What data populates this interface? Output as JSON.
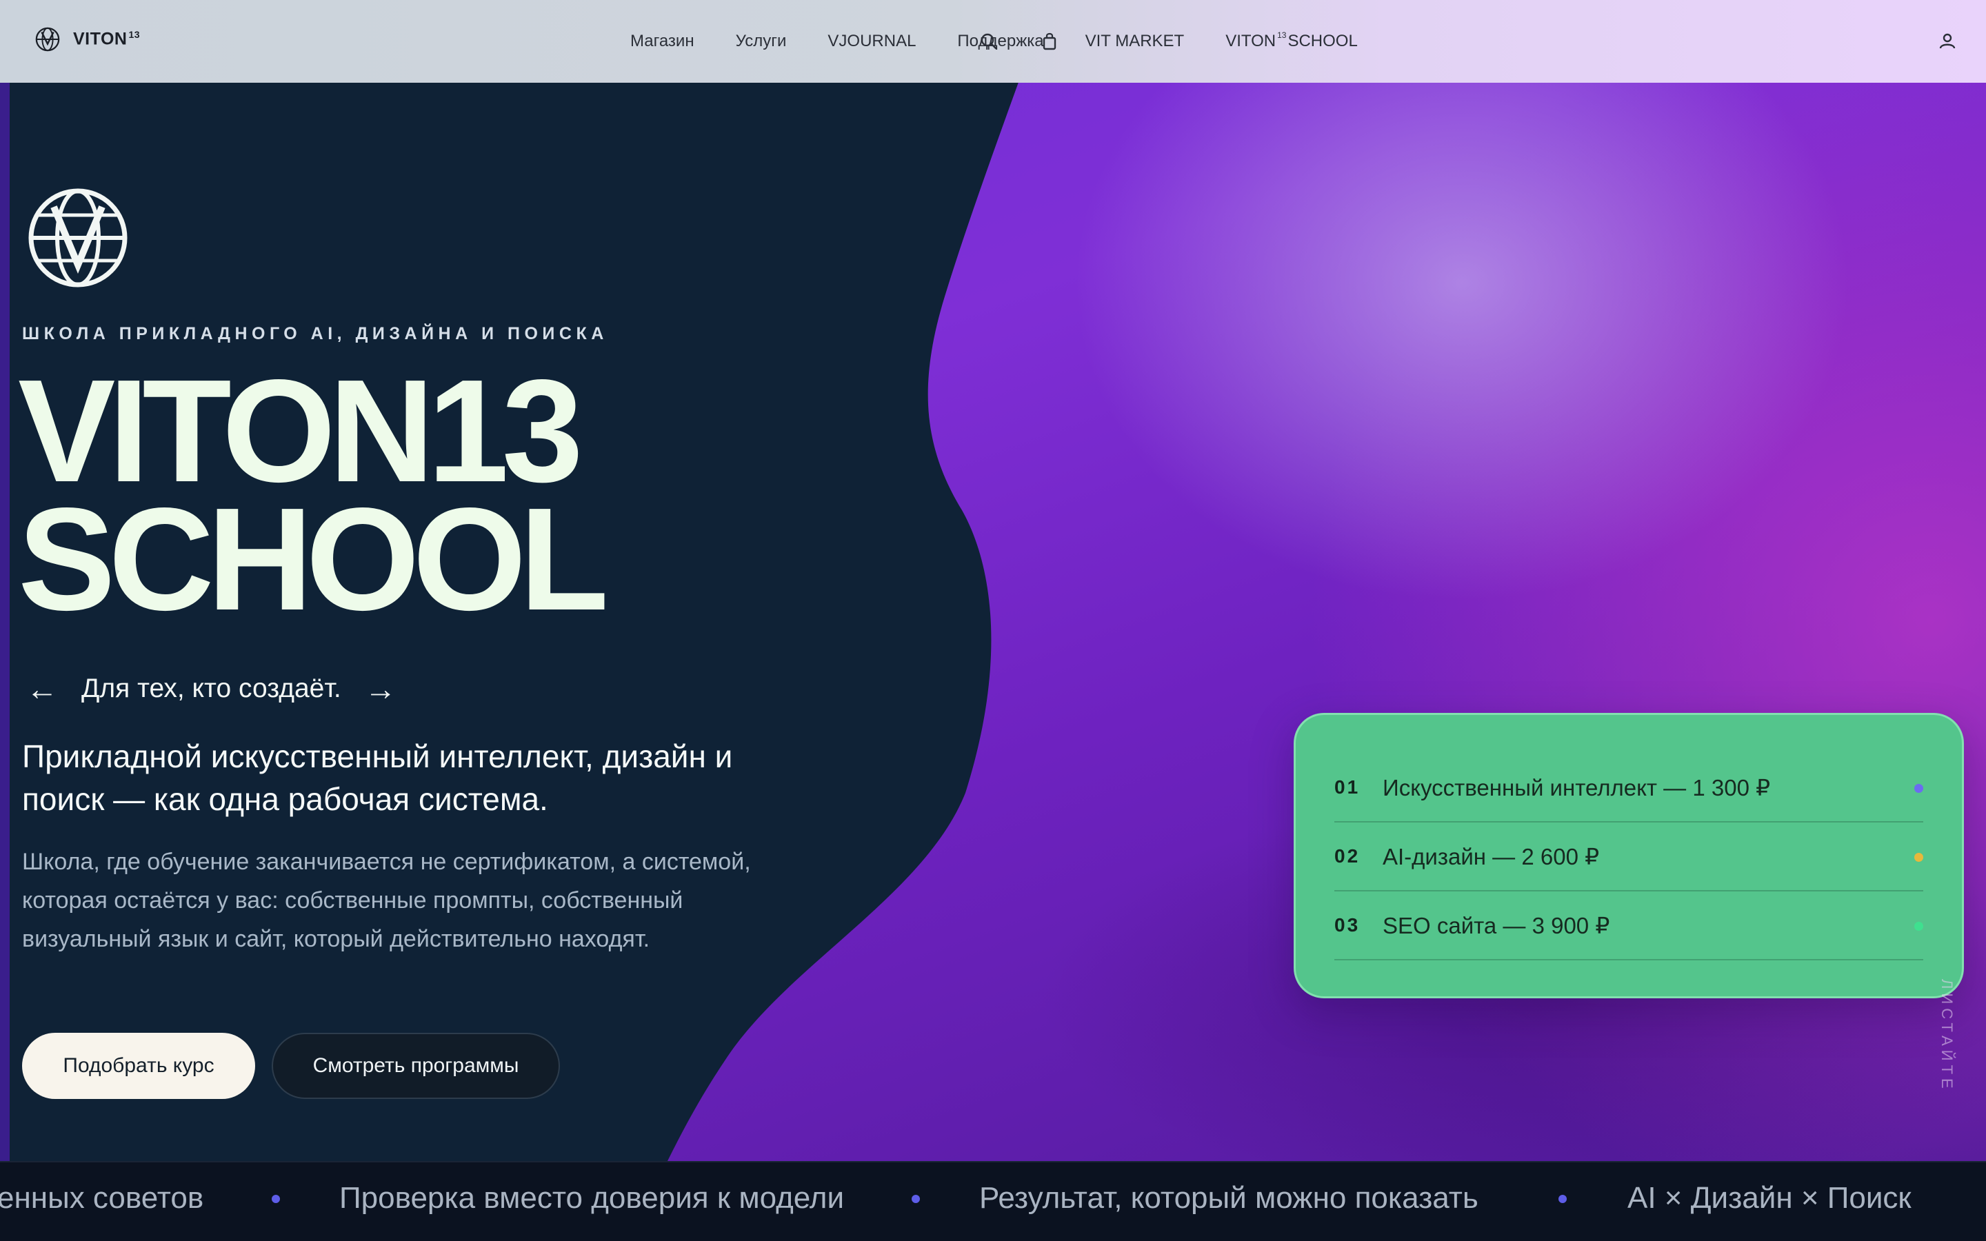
{
  "brand": {
    "name": "VITON",
    "sup": "13"
  },
  "nav": {
    "links": [
      {
        "label": "Магазин"
      },
      {
        "label": "Услуги"
      },
      {
        "label": "VJOURNAL"
      },
      {
        "label": "Поддержка"
      },
      {
        "label": "VIT MARKET"
      },
      {
        "label": "VITON",
        "sup": "13",
        "suffix": "SCHOOL"
      }
    ],
    "icons": [
      "search-icon",
      "bag-icon",
      "user-icon"
    ]
  },
  "hero": {
    "kicker": "ШКОЛА ПРИКЛАДНОГО AI, ДИЗАЙНА И ПОИСКА",
    "title_line1": "VITON13",
    "title_line2": "SCHOOL",
    "tagline": "Для тех, кто создаёт.",
    "arrow_prev": "←",
    "arrow_next": "→",
    "lead": "Прикладной искусственный интеллект, дизайн и поиск — как одна рабочая система.",
    "description": "Школа, где обучение заканчивается не сертификатом, а системой, которая остаётся у вас: собственные промпты, собственный визуальный язык и сайт, который действительно находят.",
    "primary_button": "Подобрать курс",
    "secondary_button": "Смотреть программы"
  },
  "courses": [
    {
      "num": "01",
      "label": "Искусственный интеллект — 1 300 ₽",
      "dot_color": "#6b6cf0"
    },
    {
      "num": "02",
      "label": "AI-дизайн — 2 600 ₽",
      "dot_color": "#e8b83c"
    },
    {
      "num": "03",
      "label": "SEO сайта — 3 900 ₽",
      "dot_color": "#3fe08f"
    }
  ],
  "scroll_hint": "ЛИСТАЙТЕ",
  "ticker": {
    "items": [
      "енных советов",
      "Проверка вместо доверия к модели",
      "Результат, который можно показать",
      "AI × Дизайн × Поиск"
    ]
  },
  "colors": {
    "dark_panel": "#0f2236",
    "purple": "#7f2fd6",
    "card_green": "#54c58c",
    "title": "#eefbea",
    "ticker_dot": "#5e5de8"
  }
}
